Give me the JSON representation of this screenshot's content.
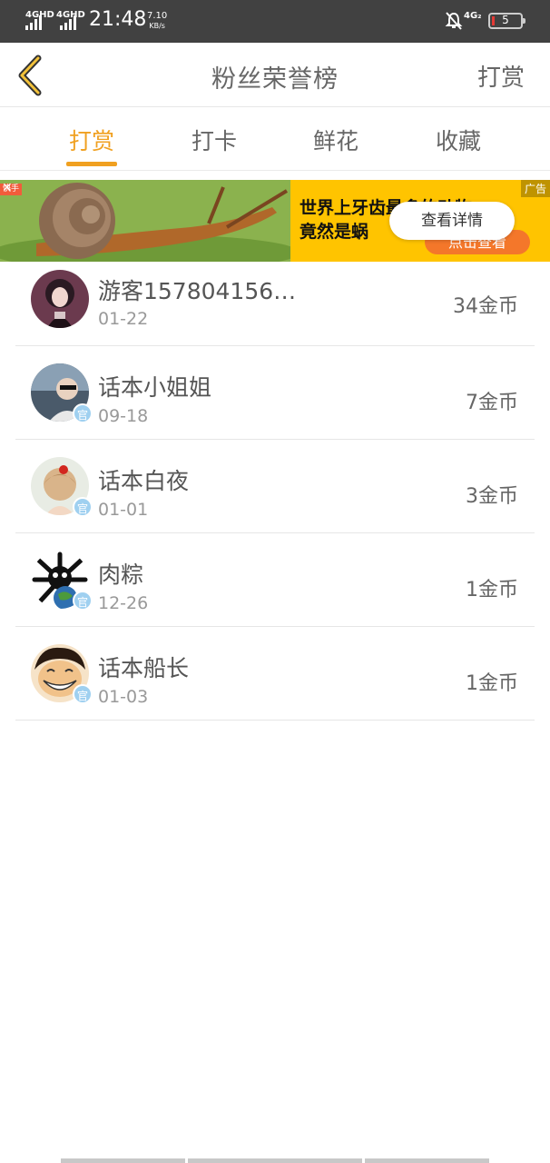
{
  "status_bar": {
    "net1": "4GHD",
    "net2": "4GHD",
    "time": "21:48",
    "speed_value": "7.10",
    "speed_unit": "KB/s",
    "net3": "4G₂",
    "battery": "5"
  },
  "header": {
    "title": "粉丝荣誉榜",
    "action": "打赏"
  },
  "tabs": [
    {
      "label": "打赏",
      "active": true
    },
    {
      "label": "打卡",
      "active": false
    },
    {
      "label": "鲜花",
      "active": false
    },
    {
      "label": "收藏",
      "active": false
    }
  ],
  "ad": {
    "source": "快手",
    "badge": "广告",
    "line1": "世界上牙齿最多的动物",
    "line2": "竟然是蜗",
    "cta": "点击查看",
    "detail_button": "查看详情"
  },
  "list": [
    {
      "name": "游客157804156…",
      "date": "01-22",
      "coins": "34金币",
      "verified": false
    },
    {
      "name": "话本小姐姐",
      "date": "09-18",
      "coins": "7金币",
      "verified": true,
      "badge": "官"
    },
    {
      "name": "话本白夜",
      "date": "01-01",
      "coins": "3金币",
      "verified": true,
      "badge": "官"
    },
    {
      "name": "肉粽",
      "date": "12-26",
      "coins": "1金币",
      "verified": true,
      "badge": "官"
    },
    {
      "name": "话本船长",
      "date": "01-03",
      "coins": "1金币",
      "verified": true,
      "badge": "官"
    }
  ],
  "colors": {
    "accent": "#f0a020",
    "status_bar": "#414141",
    "ad_yellow": "#ffc400",
    "ad_cta": "#f4772a"
  }
}
